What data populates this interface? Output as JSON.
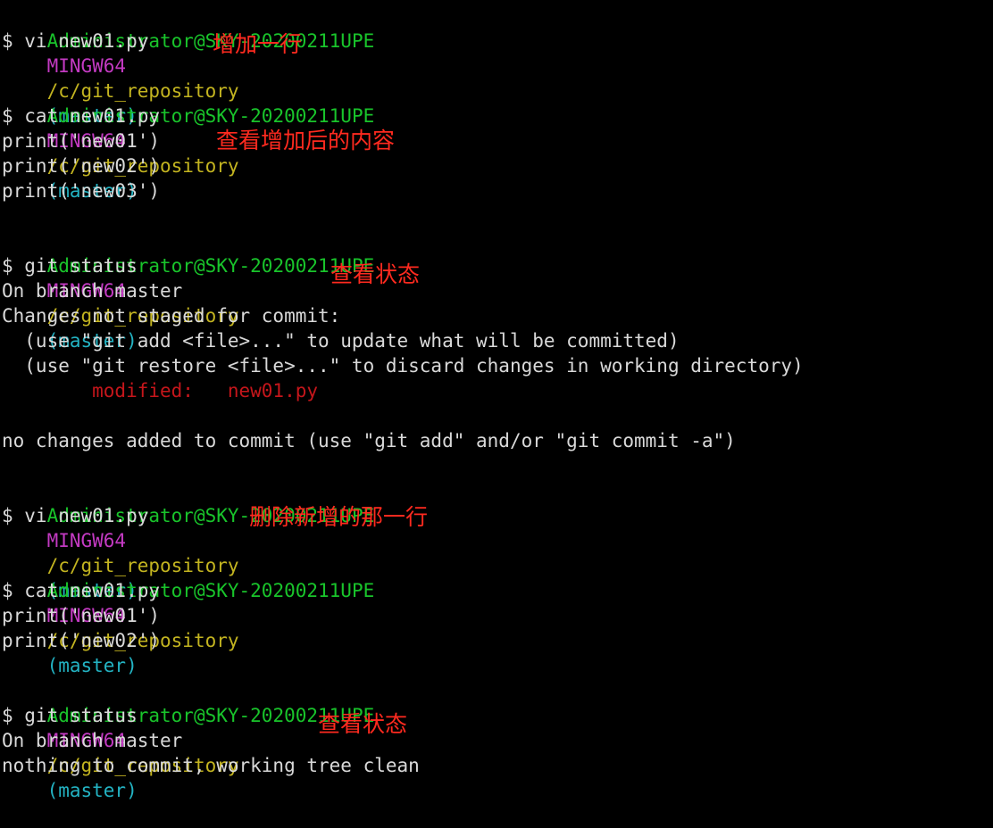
{
  "prompt": {
    "user_host": "Administrator@SKY-20200211UPE",
    "shell": "MINGW64",
    "path": "/c/git_repository",
    "branch": "(master)"
  },
  "colors": {
    "background": "#000000",
    "prompt_user": "#19c42b",
    "prompt_shell": "#c33ac2",
    "prompt_path": "#c3b420",
    "prompt_branch": "#23b3c3",
    "output": "#d9d9d9",
    "modified": "#c5161b",
    "annotation": "#ff2a1f"
  },
  "lines": {
    "cmd1": "$ vi new01.py",
    "cmd2": "$ cat new01.py",
    "out2_1": "print('new01')",
    "out2_2": "print('new02')",
    "out2_3": "print('new03')",
    "cmd3": "$ git status",
    "out3_1": "On branch master",
    "out3_2": "Changes not staged for commit:",
    "out3_3": "  (use \"git add <file>...\" to update what will be committed)",
    "out3_4": "  (use \"git restore <file>...\" to discard changes in working directory)",
    "out3_5": "        modified:   new01.py",
    "out3_6": "no changes added to commit (use \"git add\" and/or \"git commit -a\")",
    "cmd4": "$ vi new01.py",
    "cmd5": "$ cat new01.py",
    "out5_1": "print('new01')",
    "out5_2": "print('new02')",
    "cmd6": "$ git status",
    "out6_1": "On branch master",
    "out6_2": "nothing to commit, working tree clean"
  },
  "annotations": {
    "a1": "增加一行",
    "a2": "查看增加后的内容",
    "a3": "查看状态",
    "a4": "删除新增的那一行",
    "a5": "查看状态"
  }
}
